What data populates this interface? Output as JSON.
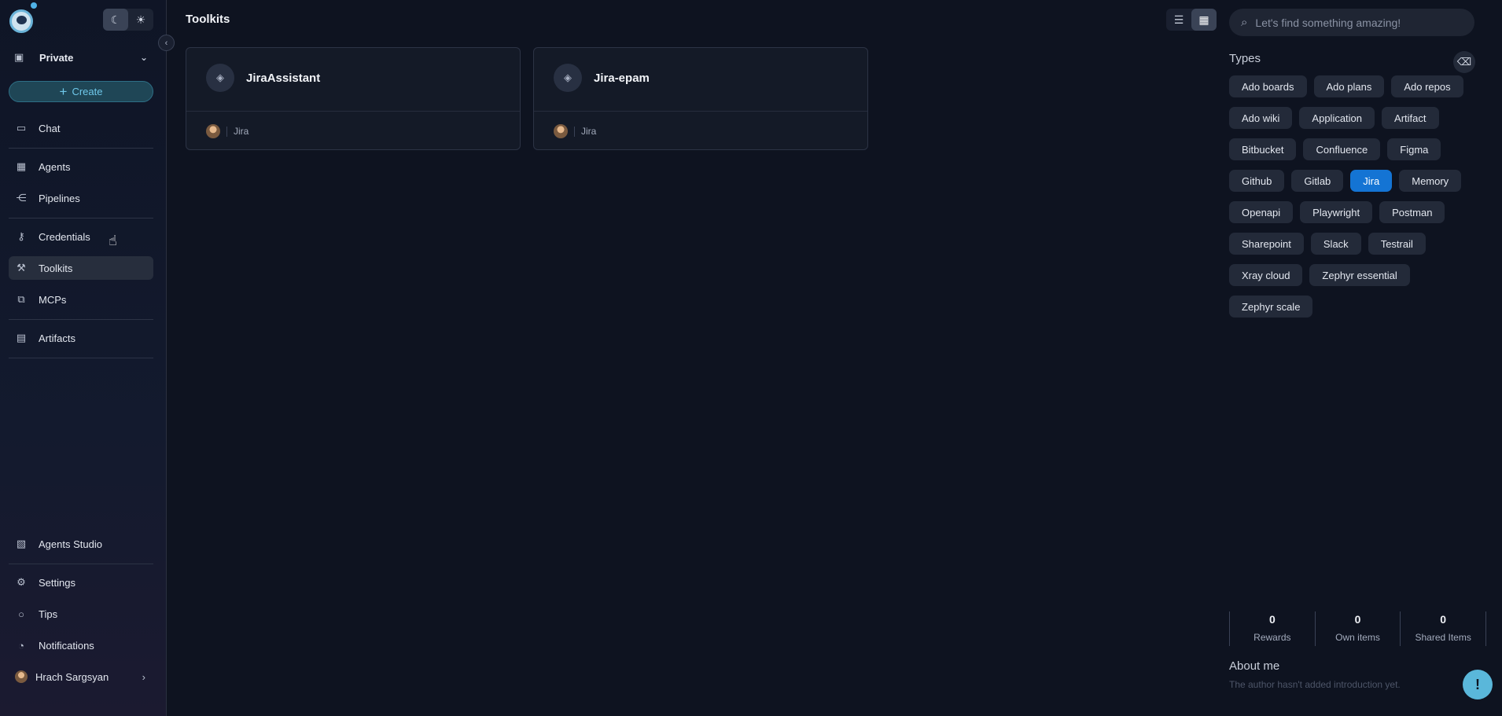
{
  "sidebar": {
    "project": "Private",
    "create_label": "Create",
    "items": [
      {
        "label": "Chat",
        "icon": "chat-icon"
      },
      {
        "label": "Agents",
        "icon": "grid-icon"
      },
      {
        "label": "Pipelines",
        "icon": "pipeline-icon"
      },
      {
        "label": "Credentials",
        "icon": "key-icon"
      },
      {
        "label": "Toolkits",
        "icon": "wrench-icon",
        "active": true
      },
      {
        "label": "MCPs",
        "icon": "mcp-icon"
      },
      {
        "label": "Artifacts",
        "icon": "artifact-icon"
      }
    ],
    "bottom_items": [
      {
        "label": "Agents Studio",
        "icon": "studio-icon"
      },
      {
        "label": "Settings",
        "icon": "gear-icon"
      },
      {
        "label": "Tips",
        "icon": "bulb-icon"
      },
      {
        "label": "Notifications",
        "icon": "bell-icon"
      }
    ],
    "user": {
      "name": "Hrach Sargsyan"
    }
  },
  "header": {
    "title": "Toolkits",
    "search_placeholder": "Let's find something amazing!"
  },
  "cards": [
    {
      "title": "JiraAssistant",
      "type": "Jira"
    },
    {
      "title": "Jira-epam",
      "type": "Jira"
    }
  ],
  "types": {
    "title": "Types",
    "selected": "Jira",
    "chips": [
      "Ado boards",
      "Ado plans",
      "Ado repos",
      "Ado wiki",
      "Application",
      "Artifact",
      "Bitbucket",
      "Confluence",
      "Figma",
      "Github",
      "Gitlab",
      "Jira",
      "Memory",
      "Openapi",
      "Playwright",
      "Postman",
      "Sharepoint",
      "Slack",
      "Testrail",
      "Xray cloud",
      "Zephyr essential",
      "Zephyr scale"
    ]
  },
  "stats": [
    {
      "value": "0",
      "label": "Rewards"
    },
    {
      "value": "0",
      "label": "Own items"
    },
    {
      "value": "0",
      "label": "Shared Items"
    }
  ],
  "about": {
    "title": "About me",
    "text": "The author hasn't added introduction yet."
  },
  "colors": {
    "accent": "#1474d4",
    "create": "#6fc8ea",
    "background": "#0e1320"
  }
}
